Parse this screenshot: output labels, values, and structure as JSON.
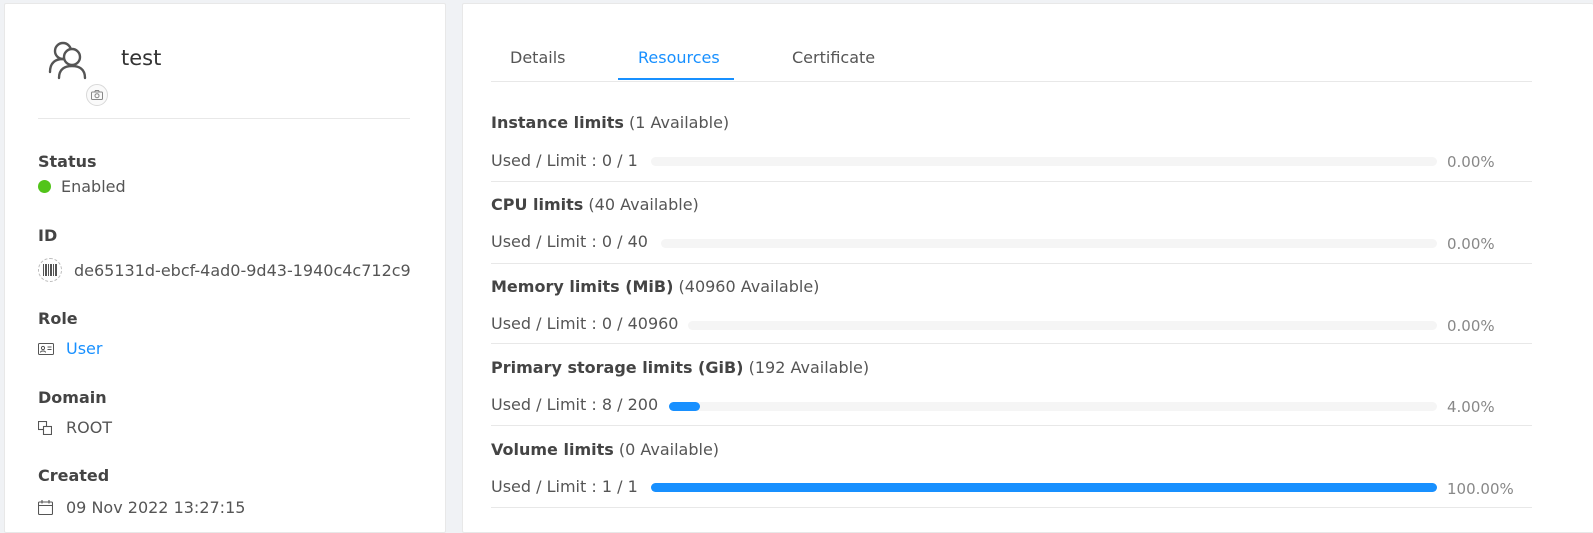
{
  "account": {
    "name": "test",
    "fields": {
      "status_label": "Status",
      "status_value": "Enabled",
      "status_color": "#52c41a",
      "id_label": "ID",
      "id_value": "de65131d-ebcf-4ad0-9d43-1940c4c712c9",
      "role_label": "Role",
      "role_value": "User",
      "domain_label": "Domain",
      "domain_value": "ROOT",
      "created_label": "Created",
      "created_value": "09 Nov 2022 13:27:15"
    }
  },
  "tabs": [
    {
      "label": "Details"
    },
    {
      "label": "Resources"
    },
    {
      "label": "Certificate"
    }
  ],
  "active_tab": "Resources",
  "accent_color": "#1890ff",
  "resources": [
    {
      "title": "Instance limits",
      "available": "(1 Available)",
      "used": "Used / Limit : 0 / 1",
      "percent_label": "0.00%",
      "fraction": 0.0
    },
    {
      "title": "CPU limits",
      "available": "(40 Available)",
      "used": "Used / Limit : 0 / 40",
      "percent_label": "0.00%",
      "fraction": 0.0
    },
    {
      "title": "Memory limits (MiB)",
      "available": "(40960 Available)",
      "used": "Used / Limit : 0 / 40960",
      "percent_label": "0.00%",
      "fraction": 0.0
    },
    {
      "title": "Primary storage limits (GiB)",
      "available": "(192 Available)",
      "used": "Used / Limit : 8 / 200",
      "percent_label": "4.00%",
      "fraction": 0.04
    },
    {
      "title": "Volume limits",
      "available": "(0 Available)",
      "used": "Used / Limit : 1 / 1",
      "percent_label": "100.00%",
      "fraction": 1.0
    }
  ]
}
